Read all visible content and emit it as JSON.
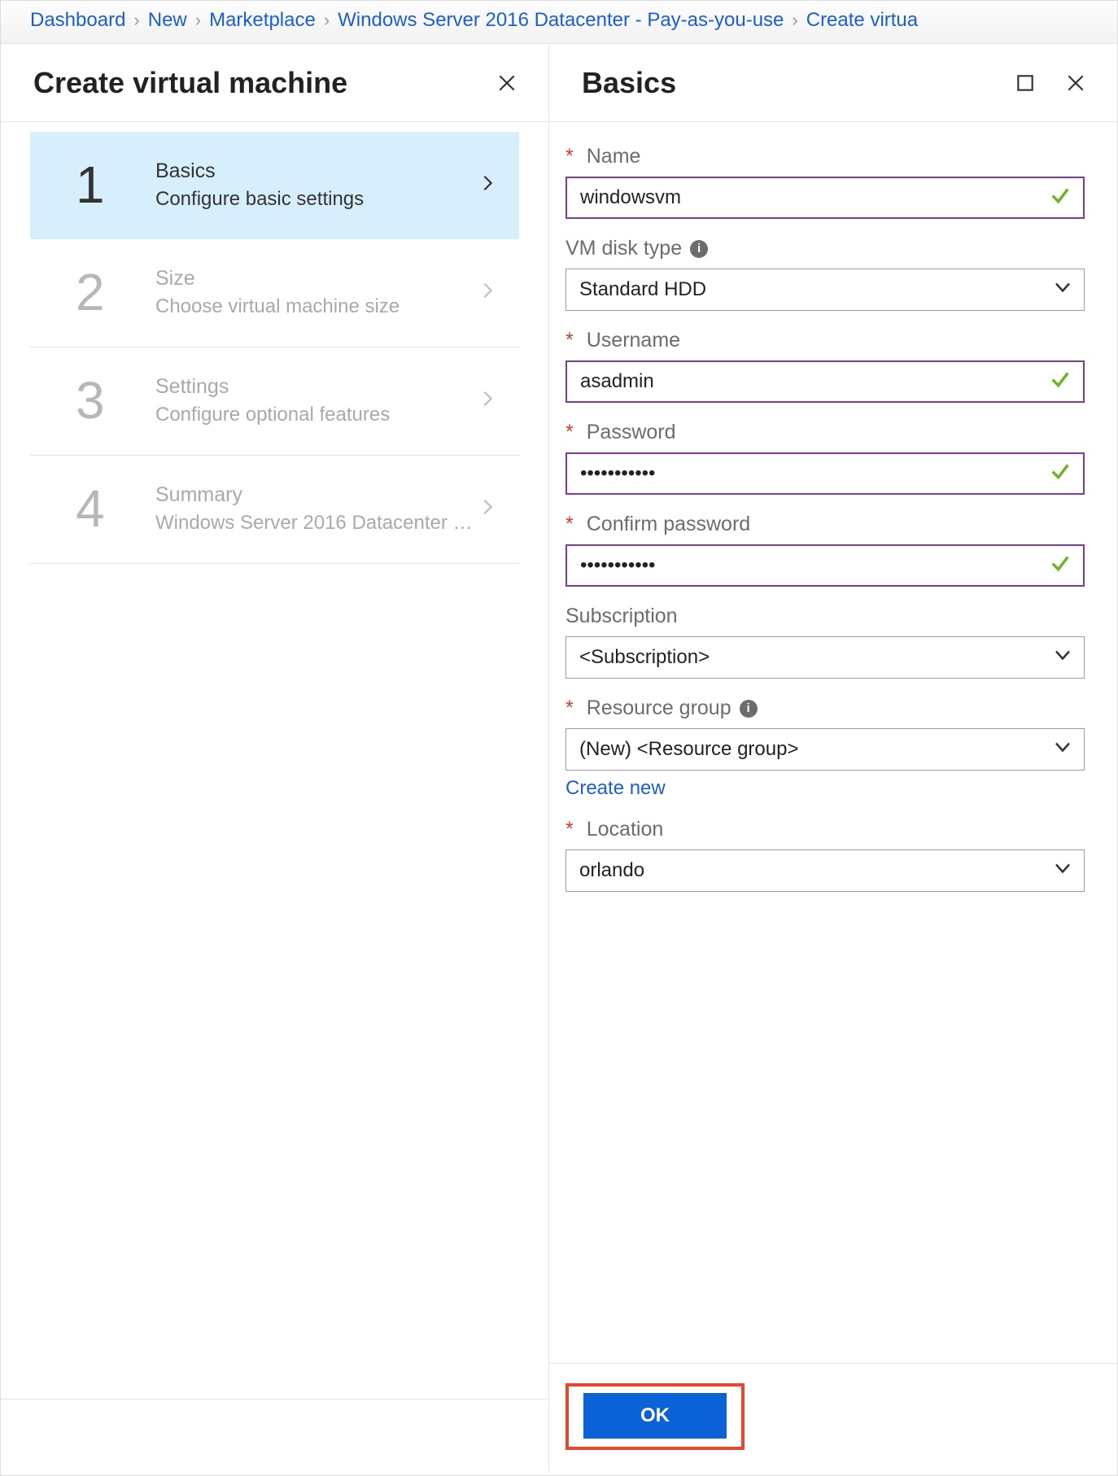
{
  "breadcrumb": {
    "items": [
      "Dashboard",
      "New",
      "Marketplace",
      "Windows Server 2016 Datacenter - Pay-as-you-use",
      "Create virtua"
    ]
  },
  "left": {
    "title": "Create virtual machine",
    "steps": [
      {
        "num": "1",
        "title": "Basics",
        "sub": "Configure basic settings",
        "active": true,
        "disabled": false
      },
      {
        "num": "2",
        "title": "Size",
        "sub": "Choose virtual machine size",
        "active": false,
        "disabled": true
      },
      {
        "num": "3",
        "title": "Settings",
        "sub": "Configure optional features",
        "active": false,
        "disabled": true
      },
      {
        "num": "4",
        "title": "Summary",
        "sub": "Windows Server 2016 Datacenter …",
        "active": false,
        "disabled": true
      }
    ]
  },
  "right": {
    "title": "Basics",
    "form": {
      "name": {
        "label": "Name",
        "required": true,
        "value": "windowsvm",
        "valid": true,
        "type": "text"
      },
      "disk": {
        "label": "VM disk type",
        "required": false,
        "value": "Standard HDD",
        "info": true,
        "type": "select"
      },
      "username": {
        "label": "Username",
        "required": true,
        "value": "asadmin",
        "valid": true,
        "type": "text"
      },
      "password": {
        "label": "Password",
        "required": true,
        "value": "•••••••••••",
        "valid": true,
        "type": "password"
      },
      "confirm": {
        "label": "Confirm password",
        "required": true,
        "value": "•••••••••••",
        "valid": true,
        "type": "password"
      },
      "subscription": {
        "label": "Subscription",
        "required": false,
        "value": "<Subscription>",
        "type": "select"
      },
      "rg": {
        "label": "Resource group",
        "required": true,
        "value": "(New)  <Resource group>",
        "info": true,
        "type": "select",
        "link": "Create new"
      },
      "location": {
        "label": "Location",
        "required": true,
        "value": "orlando",
        "type": "select"
      }
    },
    "ok_label": "OK"
  }
}
